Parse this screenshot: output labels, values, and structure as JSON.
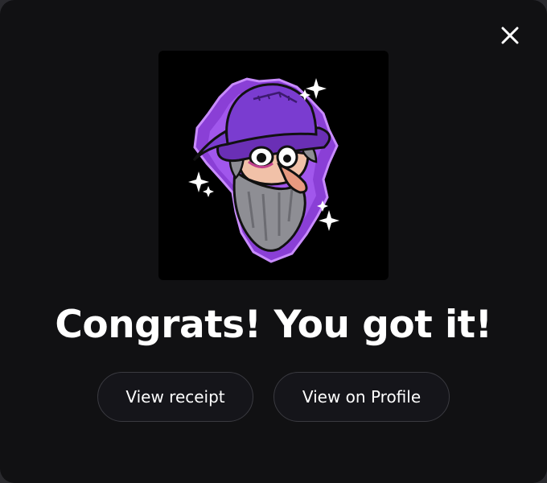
{
  "modal": {
    "headline": "Congrats! You got it!",
    "close_icon": "close-icon",
    "image_icon": "wizard-nft-image"
  },
  "actions": {
    "view_receipt_label": "View receipt",
    "view_profile_label": "View on Profile"
  },
  "colors": {
    "background": "#111113",
    "button_border": "#3a3a40",
    "accent_purple": "#8a3fd6",
    "text": "#ffffff"
  }
}
